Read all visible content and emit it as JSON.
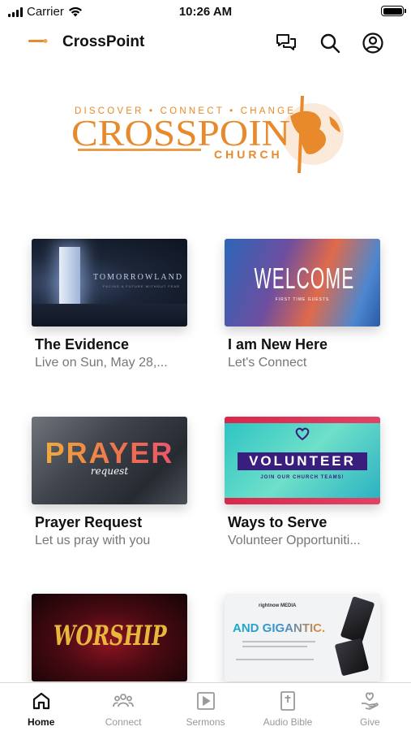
{
  "status_bar": {
    "carrier": "Carrier",
    "time": "10:26 AM"
  },
  "header": {
    "title": "CrossPoint",
    "icons": [
      "chat-icon",
      "search-icon",
      "account-icon"
    ]
  },
  "logo": {
    "tagline": "DISCOVER • CONNECT • CHANGE",
    "name": "CROSSPOIN",
    "church": "CHURCH",
    "color": "#e8892b"
  },
  "cards": [
    {
      "title": "The Evidence",
      "subtitle": "Live on Sun, May 28,...",
      "thumb_title": "TOMORROWLAND",
      "thumb_sub": "FACING A FUTURE WITHOUT FEAR"
    },
    {
      "title": "I am New Here",
      "subtitle": "Let's Connect",
      "thumb_title": "WELCOME",
      "thumb_sub": "FIRST TIME GUESTS"
    },
    {
      "title": "Prayer Request",
      "subtitle": "Let us pray with you",
      "thumb_title": "PRAYER",
      "thumb_sub": "request"
    },
    {
      "title": "Ways to Serve",
      "subtitle": "Volunteer Opportuniti...",
      "thumb_title": "VOLUNTEER",
      "thumb_sub": "JOIN OUR CHURCH TEAMS!"
    },
    {
      "thumb_title": "WORSHIP"
    },
    {
      "thumb_brand": "rightnow MEDIA",
      "thumb_title": "AND GIGANTIC."
    }
  ],
  "tab_bar": {
    "tabs": [
      {
        "label": "Home",
        "icon": "home-icon",
        "active": true
      },
      {
        "label": "Connect",
        "icon": "people-icon",
        "active": false
      },
      {
        "label": "Sermons",
        "icon": "video-icon",
        "active": false
      },
      {
        "label": "Audio Bible",
        "icon": "bible-icon",
        "active": false
      },
      {
        "label": "Give",
        "icon": "give-icon",
        "active": false
      }
    ]
  },
  "colors": {
    "accent": "#e8892b",
    "text": "#111111",
    "muted": "#777777",
    "tab_inactive": "#999999"
  }
}
